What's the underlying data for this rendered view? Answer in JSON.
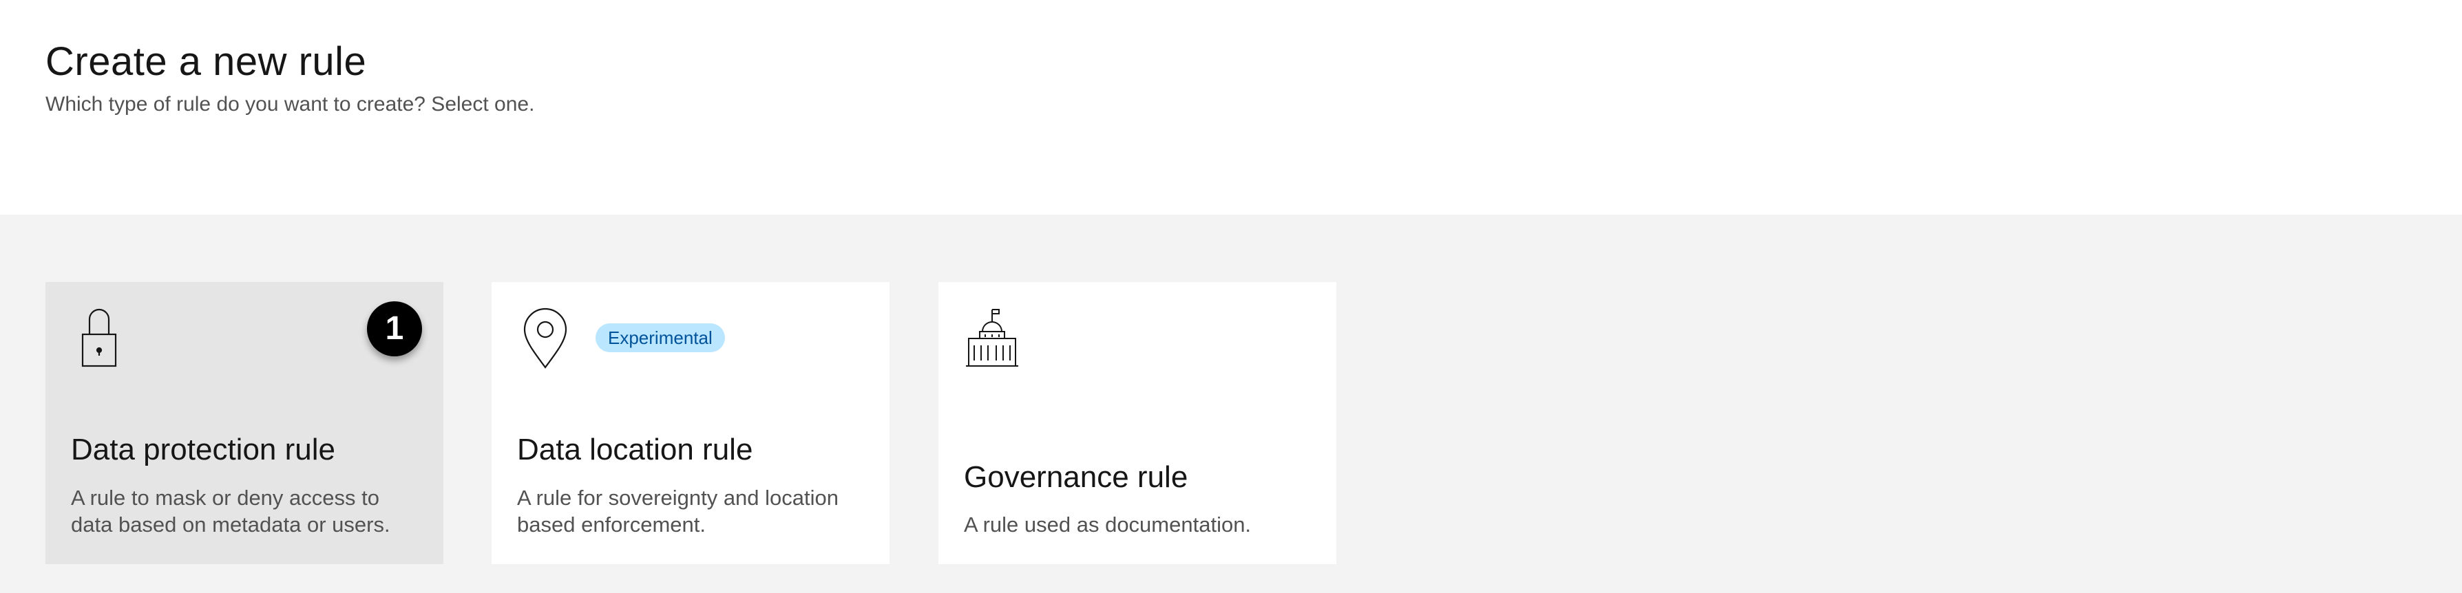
{
  "page": {
    "title": "Create a new rule",
    "subtitle": "Which type of rule do you want to create? Select one."
  },
  "cards": [
    {
      "icon": "lock-icon",
      "title": "Data protection rule",
      "description": "A rule to mask or deny access to data based on metadata or users.",
      "selected": true,
      "step_badge": "1"
    },
    {
      "icon": "location-pin-icon",
      "title": "Data location rule",
      "description": "A rule for sovereignty and location based enforcement.",
      "tag": "Experimental",
      "selected": false
    },
    {
      "icon": "government-building-icon",
      "title": "Governance rule",
      "description": "A rule used as documentation.",
      "selected": false
    }
  ],
  "colors": {
    "page_background": "#ffffff",
    "content_background": "#f3f3f3",
    "card_background": "#ffffff",
    "card_selected_background": "#e5e5e5",
    "tag_background": "#bae6ff",
    "tag_text": "#00539a",
    "badge_background": "#000000"
  }
}
